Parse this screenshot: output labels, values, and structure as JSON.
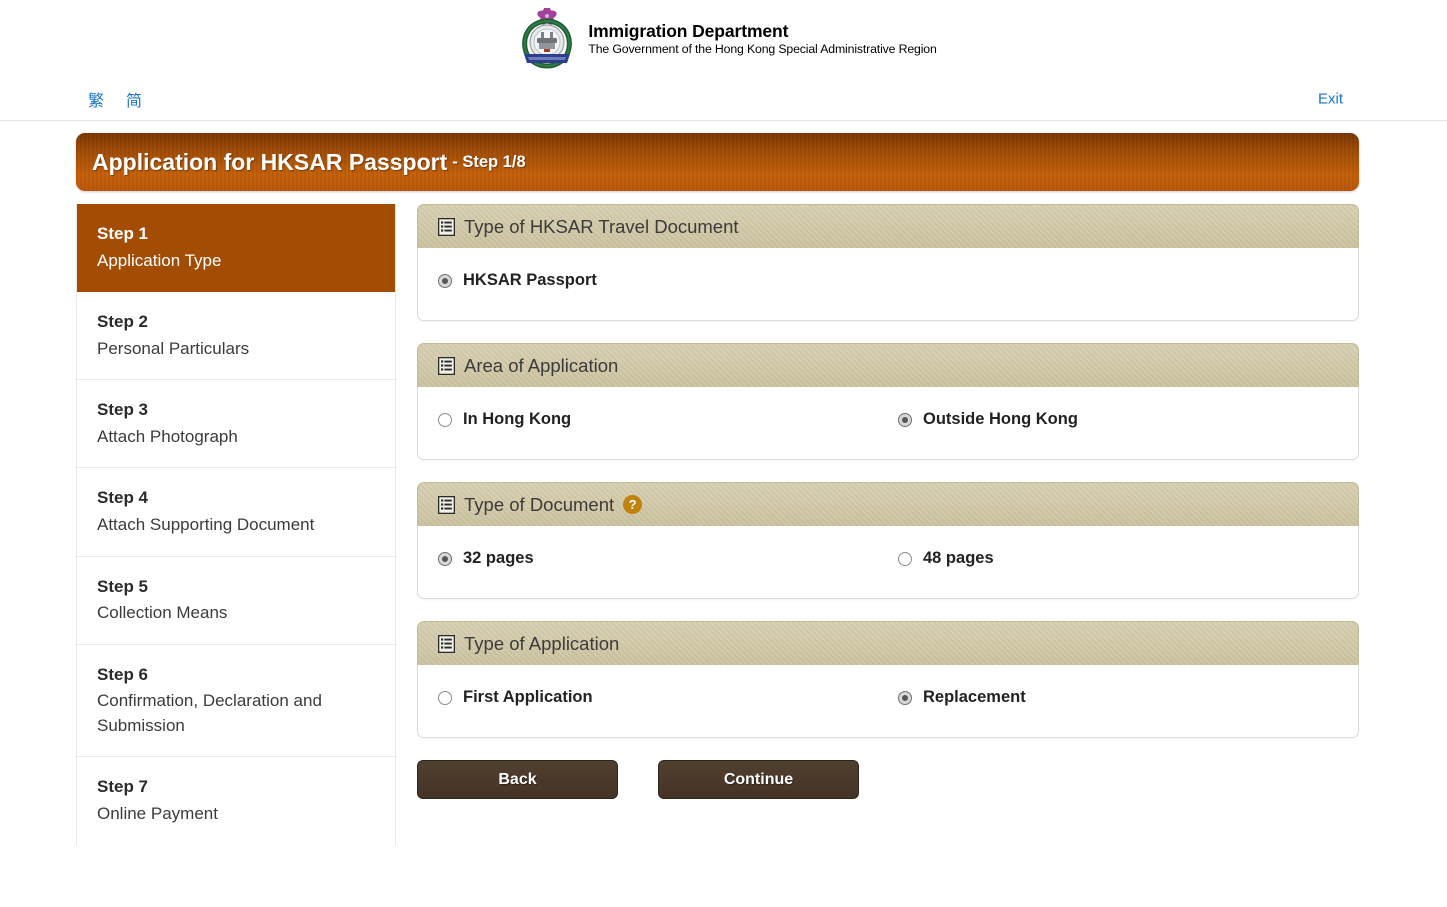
{
  "header": {
    "org_name": "Immigration Department",
    "org_sub": "The Government of the Hong Kong Special Administrative Region",
    "crest_icon": "hksar-immigration-crest-icon"
  },
  "utilbar": {
    "lang_traditional": "繁",
    "lang_simplified": "简",
    "exit_label": "Exit"
  },
  "title": {
    "main": "Application for HKSAR Passport",
    "step": "- Step 1/8"
  },
  "sidebar": {
    "steps": [
      {
        "num": "Step 1",
        "label": "Application Type",
        "active": true
      },
      {
        "num": "Step 2",
        "label": "Personal Particulars",
        "active": false
      },
      {
        "num": "Step 3",
        "label": "Attach Photograph",
        "active": false
      },
      {
        "num": "Step 4",
        "label": "Attach Supporting Document",
        "active": false
      },
      {
        "num": "Step 5",
        "label": "Collection Means",
        "active": false
      },
      {
        "num": "Step 6",
        "label": "Confirmation, Declaration and Submission",
        "active": false
      },
      {
        "num": "Step 7",
        "label": "Online Payment",
        "active": false
      }
    ]
  },
  "panels": [
    {
      "icon": "list-icon",
      "title": "Type of HKSAR Travel Document",
      "has_help": false,
      "options": [
        {
          "label": "HKSAR Passport",
          "checked": true
        }
      ]
    },
    {
      "icon": "list-icon",
      "title": "Area of Application",
      "has_help": false,
      "options": [
        {
          "label": "In Hong Kong",
          "checked": false
        },
        {
          "label": "Outside Hong Kong",
          "checked": true
        }
      ]
    },
    {
      "icon": "list-icon",
      "title": "Type of Document",
      "has_help": true,
      "help_glyph": "?",
      "options": [
        {
          "label": "32 pages",
          "checked": true
        },
        {
          "label": "48 pages",
          "checked": false
        }
      ]
    },
    {
      "icon": "list-icon",
      "title": "Type of Application",
      "has_help": false,
      "options": [
        {
          "label": "First Application",
          "checked": false
        },
        {
          "label": "Replacement",
          "checked": true
        }
      ]
    }
  ],
  "buttons": {
    "back": "Back",
    "continue": "Continue"
  },
  "colors": {
    "title_bar": "#b9570a",
    "active_step": "#a34d04",
    "panel_head": "#cfc7a5",
    "button": "#4a392b",
    "link": "#1a73cc",
    "help_icon": "#c0820a"
  }
}
